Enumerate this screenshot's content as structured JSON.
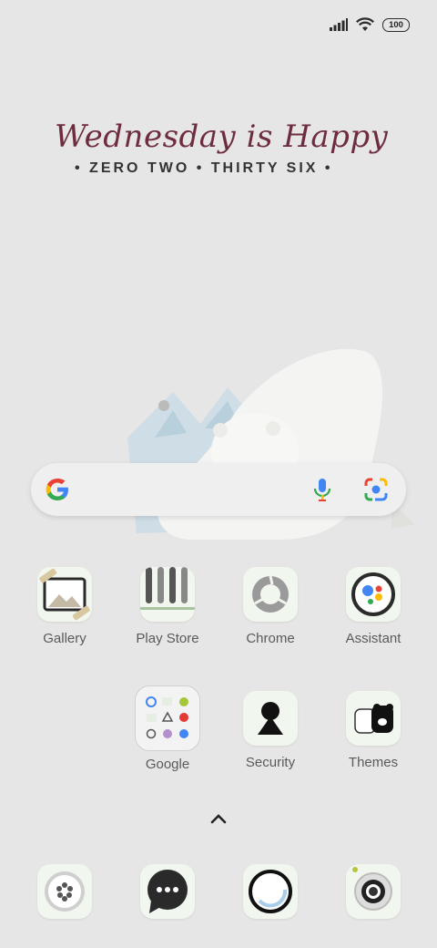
{
  "status_bar": {
    "battery": "100"
  },
  "widget": {
    "script_text": "Wednesday is Happy",
    "time_text": "• ZERO TWO • THIRTY SIX •"
  },
  "search": {},
  "apps": [
    {
      "label": "Gallery"
    },
    {
      "label": "Play Store"
    },
    {
      "label": "Chrome"
    },
    {
      "label": "Assistant"
    },
    {
      "label": "Google"
    },
    {
      "label": "Security"
    },
    {
      "label": "Themes"
    }
  ],
  "dock": {
    "items": [
      "apps-icon",
      "messages-icon",
      "browser-icon",
      "camera-icon"
    ]
  },
  "colors": {
    "background": "#e6e6e6",
    "widget_script": "#6e2d3f",
    "tile": "#f1f6ef"
  }
}
